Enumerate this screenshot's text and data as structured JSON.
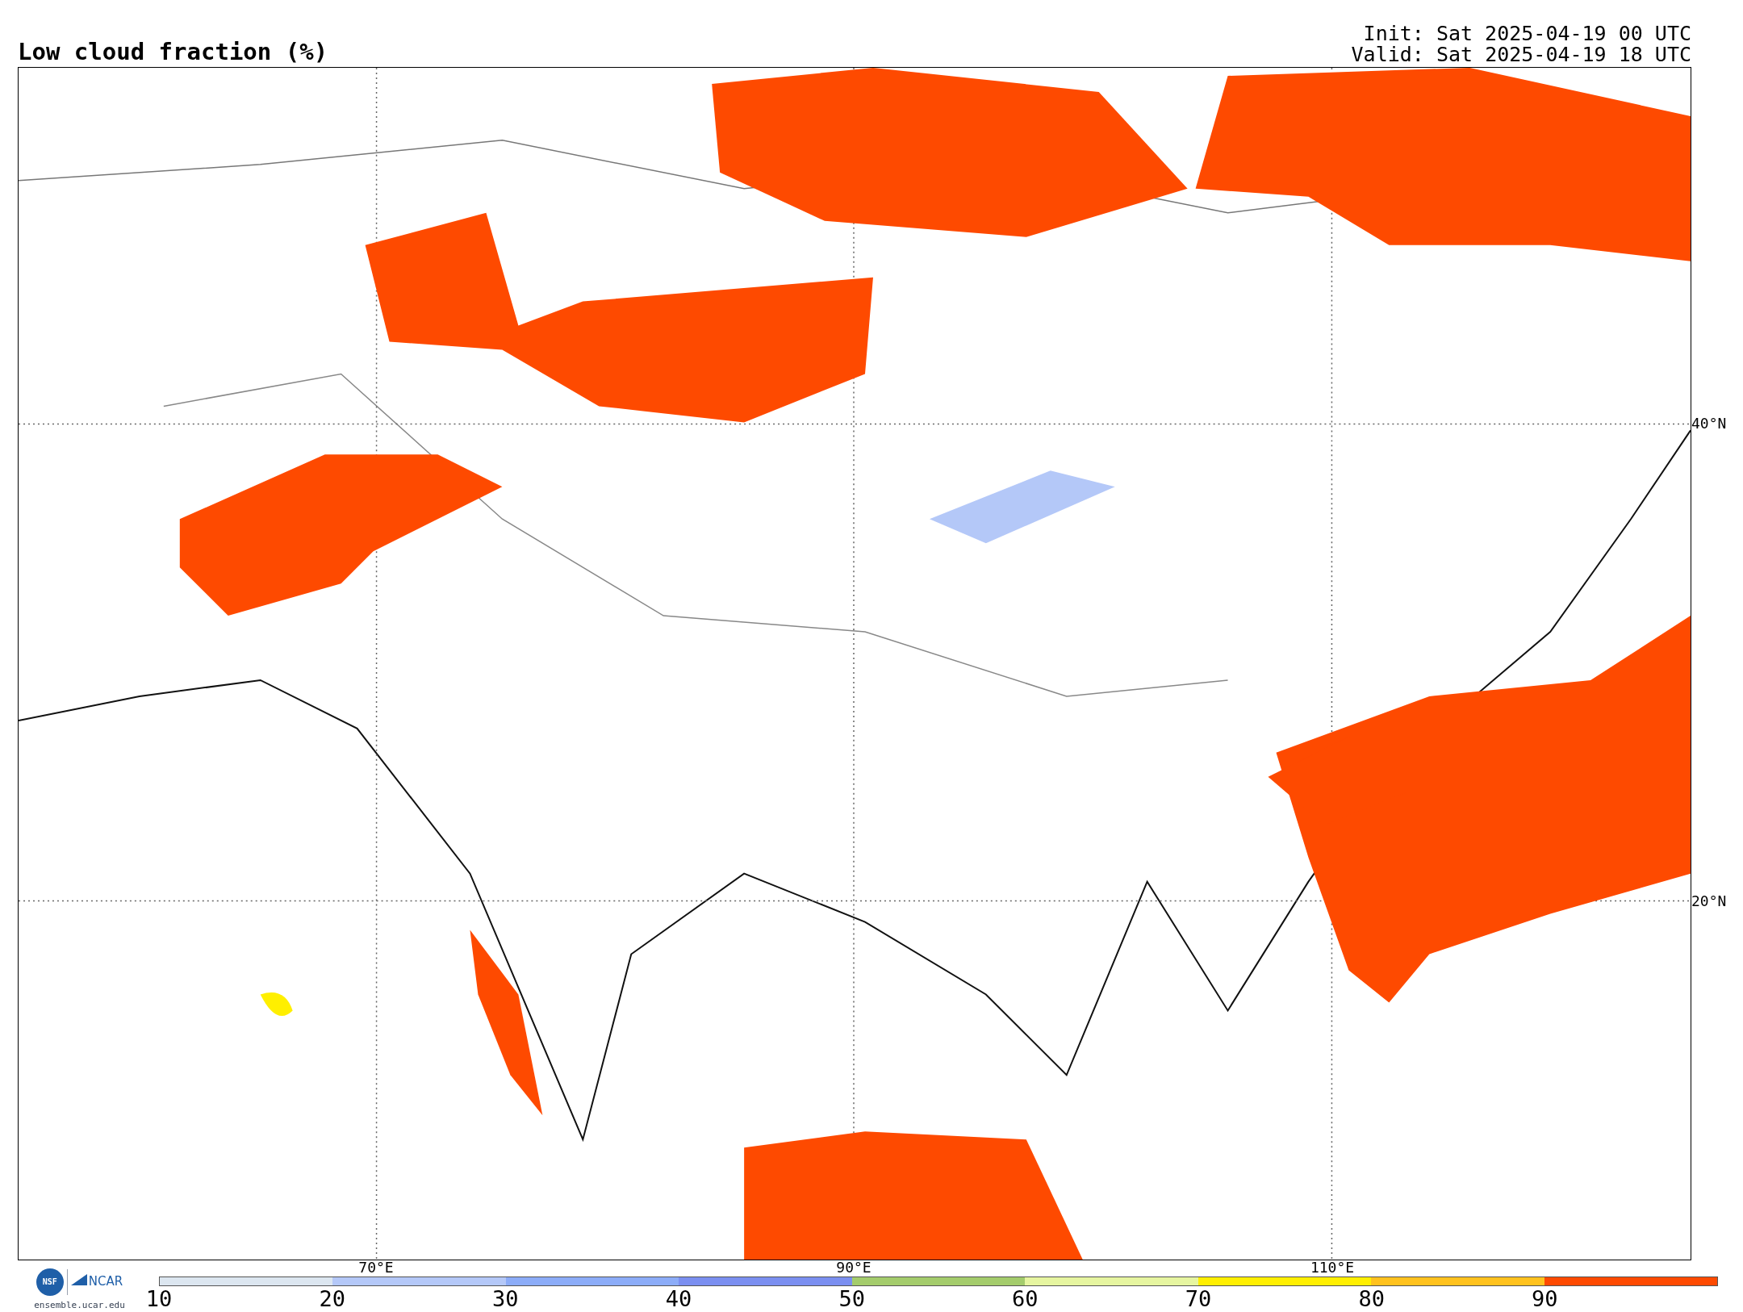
{
  "title": "Low cloud fraction (%)",
  "run_info": [
    "Init: Sat 2025-04-19 00 UTC",
    "Valid: Sat 2025-04-19 18 UTC"
  ],
  "map": {
    "latitude_labels": [
      "40°N",
      "20°N"
    ],
    "longitude_labels": [
      "70°E",
      "90°E",
      "110°E"
    ]
  },
  "logos": {
    "nsf": "NSF",
    "ncar": "NCAR",
    "site": "ensemble.ucar.edu"
  },
  "colorbar": {
    "ticks": [
      "10",
      "20",
      "30",
      "40",
      "50",
      "60",
      "70",
      "80",
      "90"
    ],
    "segments": [
      {
        "color": "#dce6f0"
      },
      {
        "color": "#b4c8f8"
      },
      {
        "color": "#8cacf8"
      },
      {
        "color": "#7b8ff0"
      },
      {
        "color": "#a4cc6c"
      },
      {
        "color": "#e6f5a0"
      },
      {
        "color": "#ffef00"
      },
      {
        "color": "#ffc21e"
      },
      {
        "color": "#fe4a00"
      }
    ]
  }
}
